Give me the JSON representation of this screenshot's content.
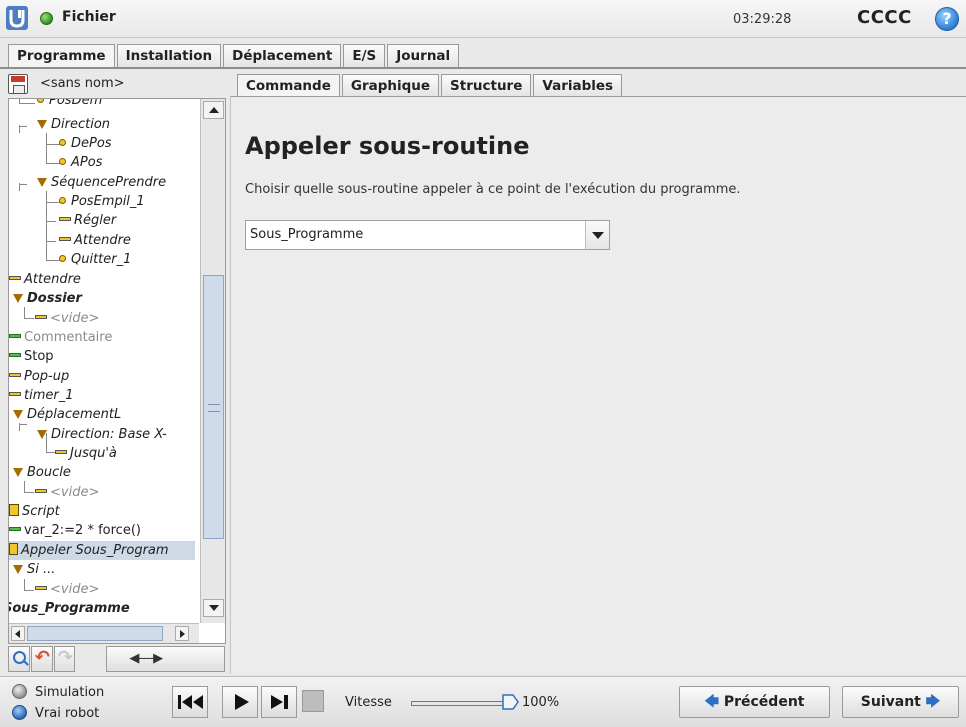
{
  "topbar": {
    "file_menu": "Fichier",
    "time": "03:29:28",
    "robot_name": "CCCC",
    "help": "?"
  },
  "main_tabs": [
    "Programme",
    "Installation",
    "Déplacement",
    "E/S",
    "Journal"
  ],
  "program": {
    "name": "<sans nom>"
  },
  "tree": [
    {
      "label": "PosDem",
      "icon": "waypoint"
    },
    {
      "label": "Direction",
      "icon": "triangle"
    },
    {
      "label": "DePos",
      "icon": "waypoint"
    },
    {
      "label": "APos",
      "icon": "waypoint"
    },
    {
      "label": "SéquencePrendre",
      "icon": "triangle"
    },
    {
      "label": "PosEmpil_1",
      "icon": "waypoint"
    },
    {
      "label": "Régler",
      "icon": "bar"
    },
    {
      "label": "Attendre",
      "icon": "bar"
    },
    {
      "label": "Quitter_1",
      "icon": "waypoint"
    },
    {
      "label": "Attendre",
      "icon": "bar"
    },
    {
      "label": "Dossier",
      "icon": "triangle"
    },
    {
      "label": "<vide>",
      "icon": "bar"
    },
    {
      "label": "Commentaire",
      "icon": "bar-green"
    },
    {
      "label": "Stop",
      "icon": "bar-green"
    },
    {
      "label": "Pop-up",
      "icon": "bar"
    },
    {
      "label": "timer_1",
      "icon": "bar"
    },
    {
      "label": "DéplacementL",
      "icon": "triangle"
    },
    {
      "label": "Direction: Base X-",
      "icon": "triangle"
    },
    {
      "label": "Jusqu'à",
      "icon": "bar"
    },
    {
      "label": "Boucle",
      "icon": "triangle"
    },
    {
      "label": "<vide>",
      "icon": "bar"
    },
    {
      "label": "Script",
      "icon": "script"
    },
    {
      "label": "var_2:=2 * force()",
      "icon": "bar-green"
    },
    {
      "label": "Appeler Sous_Program",
      "icon": "flag"
    },
    {
      "label": "Si ...",
      "icon": "triangle"
    },
    {
      "label": "<vide>",
      "icon": "bar"
    },
    {
      "label": "Sous_Programme",
      "icon": "none"
    }
  ],
  "sub_tabs": [
    "Commande",
    "Graphique",
    "Structure",
    "Variables"
  ],
  "content": {
    "title": "Appeler sous-routine",
    "description": "Choisir quelle sous-routine appeler à ce point de l'exécution du programme.",
    "selected_subroutine": "Sous_Programme"
  },
  "bottom": {
    "mode_simulation": "Simulation",
    "mode_real": "Vrai robot",
    "speed_label": "Vitesse",
    "speed_value": "100%",
    "speed_fraction": 1.0,
    "prev_label": "Précédent",
    "next_label": "Suivant"
  },
  "colors": {
    "accent_blue": "#2d6fc4",
    "status_green": "#2f8f1d",
    "node_yellow": "#f1c52c",
    "node_green": "#4fbf4a",
    "selection": "#cfd9e5"
  }
}
